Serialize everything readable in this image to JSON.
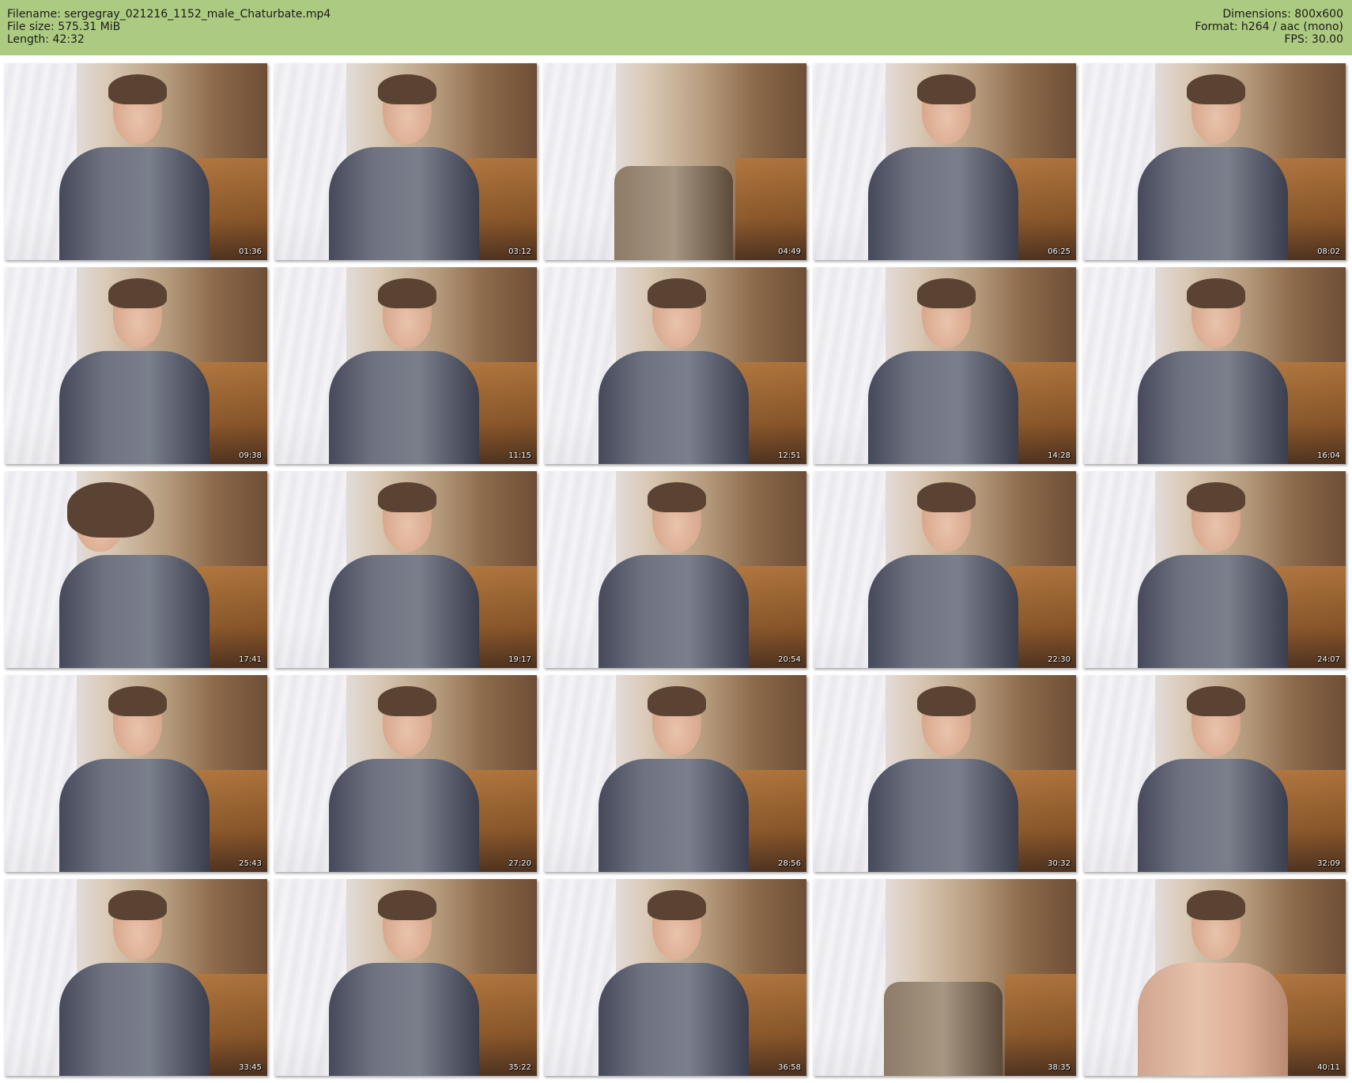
{
  "header": {
    "filename": "Filename: sergegray_021216_1152_male_Chaturbate.mp4",
    "filesize": "File size: 575.31 MiB",
    "length": "Length: 42:32",
    "dimensions": "Dimensions: 800x600",
    "format": "Format: h264 / aac (mono)",
    "fps": "FPS: 30.00",
    "background_color": "#adcb80"
  },
  "thumbnails": [
    {
      "time": "01:36"
    },
    {
      "time": "03:12"
    },
    {
      "time": "04:49"
    },
    {
      "time": "06:25"
    },
    {
      "time": "08:02"
    },
    {
      "time": "09:38"
    },
    {
      "time": "11:15"
    },
    {
      "time": "12:51"
    },
    {
      "time": "14:28"
    },
    {
      "time": "16:04"
    },
    {
      "time": "17:41"
    },
    {
      "time": "19:17"
    },
    {
      "time": "20:54"
    },
    {
      "time": "22:30"
    },
    {
      "time": "24:07"
    },
    {
      "time": "25:43"
    },
    {
      "time": "27:20"
    },
    {
      "time": "28:56"
    },
    {
      "time": "30:32"
    },
    {
      "time": "32:09"
    },
    {
      "time": "33:45"
    },
    {
      "time": "35:22"
    },
    {
      "time": "36:58"
    },
    {
      "time": "38:35"
    },
    {
      "time": "40:11"
    }
  ]
}
